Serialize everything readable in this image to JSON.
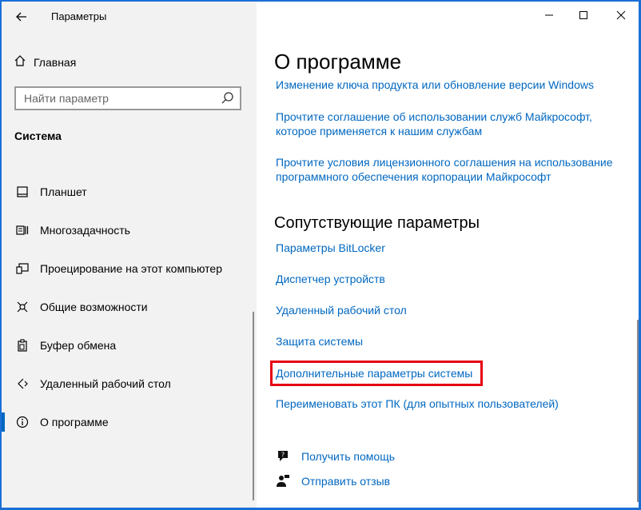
{
  "window": {
    "app_title": "Параметры",
    "controls": {
      "minimize": "—",
      "maximize": "☐",
      "close": "✕"
    }
  },
  "sidebar": {
    "home_label": "Главная",
    "search_placeholder": "Найти параметр",
    "section_title": "Система",
    "items": [
      {
        "label": "Планшет",
        "icon": "tablet-icon"
      },
      {
        "label": "Многозадачность",
        "icon": "multitasking-icon"
      },
      {
        "label": "Проецирование на этот компьютер",
        "icon": "projecting-icon"
      },
      {
        "label": "Общие возможности",
        "icon": "shared-experiences-icon"
      },
      {
        "label": "Буфер обмена",
        "icon": "clipboard-icon"
      },
      {
        "label": "Удаленный рабочий стол",
        "icon": "remote-desktop-icon"
      },
      {
        "label": "О программе",
        "icon": "info-icon",
        "active": true
      }
    ]
  },
  "main": {
    "title": "О программе",
    "links": [
      {
        "lines": [
          "Изменение ключа продукта или обновление версии Windows"
        ]
      },
      {
        "lines": [
          "Прочтите соглашение об использовании служб Майкрософт,",
          "которое применяется к нашим службам"
        ]
      },
      {
        "lines": [
          "Прочтите условия лицензионного соглашения на использование",
          "программного обеспечения корпорации Майкрософт"
        ]
      }
    ],
    "related_title": "Сопутствующие параметры",
    "related_links": [
      "Параметры BitLocker",
      "Диспетчер устройств",
      "Удаленный рабочий стол",
      "Защита системы",
      "Дополнительные параметры системы",
      "Переименовать этот ПК (для опытных пользователей)"
    ],
    "help": {
      "get_help": "Получить помощь",
      "feedback": "Отправить отзыв"
    }
  },
  "colors": {
    "accent": "#0067c0",
    "highlight_border": "#e60012",
    "sidebar_bg": "#f2f2f2"
  }
}
